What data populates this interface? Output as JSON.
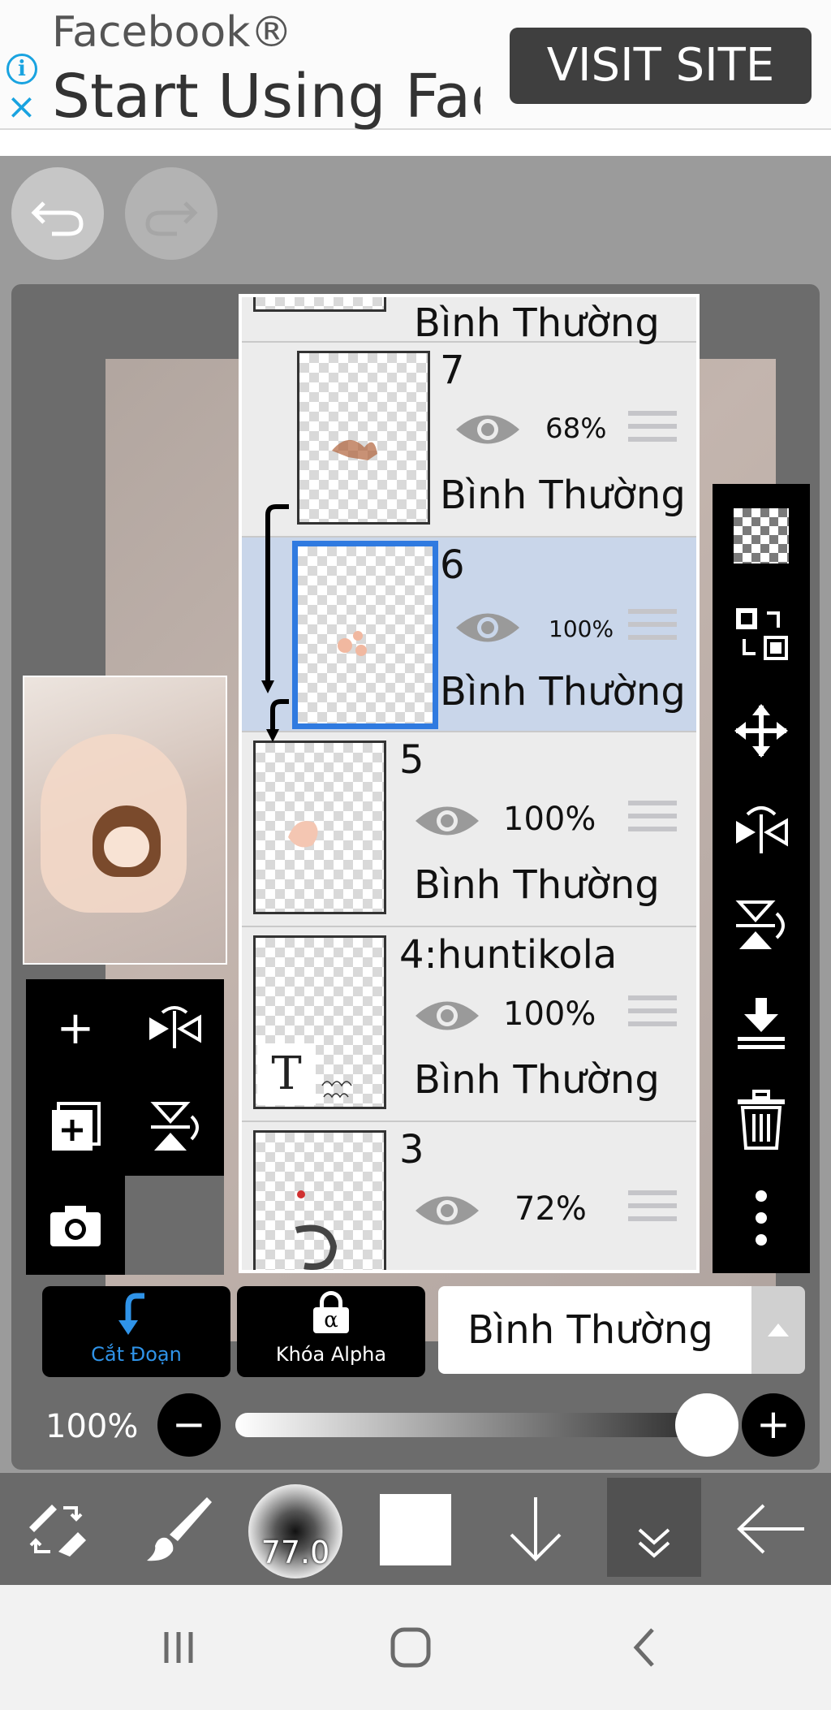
{
  "ad": {
    "brand": "Facebook®",
    "headline": "Start Using Facebook",
    "cta": "VISIT SITE"
  },
  "layers": [
    {
      "name": "",
      "opacity": "",
      "mode": "Bình Thường",
      "visible": true,
      "selected": false,
      "clipped": false
    },
    {
      "name": "7",
      "opacity": "68%",
      "mode": "Bình Thường",
      "visible": true,
      "selected": false,
      "clipped": true
    },
    {
      "name": "6",
      "opacity": "100%",
      "mode": "Bình Thường",
      "visible": true,
      "selected": true,
      "clipped": true
    },
    {
      "name": "5",
      "opacity": "100%",
      "mode": "Bình Thường",
      "visible": true,
      "selected": false,
      "clipped": false
    },
    {
      "name": "4:huntikola",
      "opacity": "100%",
      "mode": "Bình Thường",
      "visible": true,
      "selected": false,
      "clipped": false,
      "text_layer_icon": "T"
    },
    {
      "name": "3",
      "opacity": "72%",
      "mode": "",
      "visible": true,
      "selected": false,
      "clipped": false
    }
  ],
  "controls": {
    "clip_label": "Cắt Đoạn",
    "alpha_lock_label": "Khóa Alpha",
    "alpha_symbol": "α",
    "blend_mode": "Bình Thường",
    "opacity_label": "100%",
    "opacity_value": 1.0
  },
  "toolbar": {
    "brush_size": "77.0"
  },
  "colors": {
    "accent": "#2f7ae0",
    "selected_layer_bg": "#c9d6ea",
    "ad_icon": "#19a3e0",
    "panel_bg": "#ececec"
  },
  "icons": {
    "left_tools": [
      "plus-icon",
      "flip-horizontal-icon",
      "add-layer-icon",
      "flip-vertical-icon",
      "camera-icon"
    ],
    "right_tools": [
      "transparency-icon",
      "swap-icon",
      "move-icon",
      "flip-horizontal-icon",
      "flip-vertical-icon",
      "merge-down-icon",
      "trash-icon",
      "more-icon"
    ],
    "toolbar": [
      "tool-switch-icon",
      "brush-icon",
      "brush-size-icon",
      "color-icon",
      "down-arrow-icon",
      "double-chevron-icon",
      "back-arrow-icon"
    ],
    "nav": [
      "recents-icon",
      "home-icon",
      "back-icon"
    ]
  }
}
